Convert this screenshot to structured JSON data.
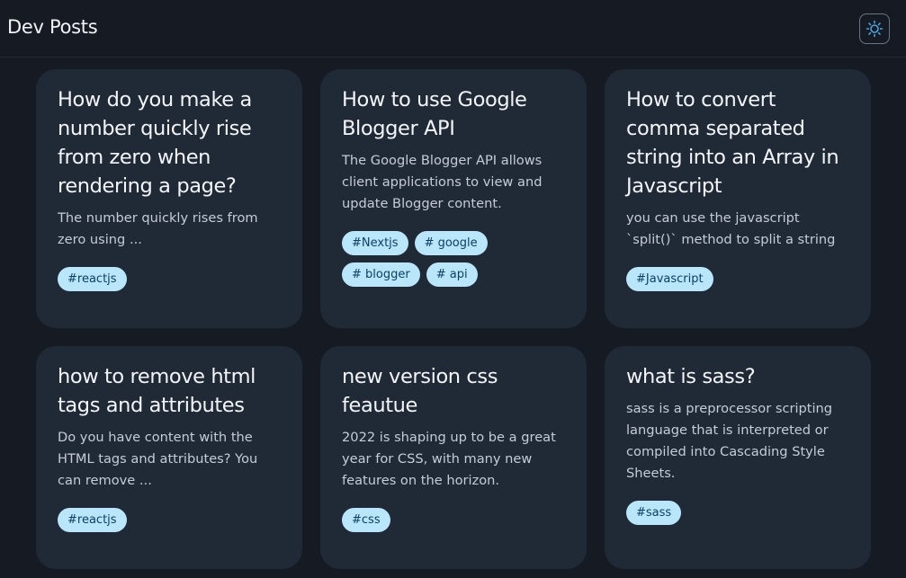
{
  "header": {
    "title": "Dev Posts",
    "theme_toggle_icon": "sun-icon",
    "accent_color": "#4aa3df"
  },
  "posts": [
    {
      "title": "How do you make a number quickly rise from zero when rendering a page?",
      "description": "The number quickly rises from zero using ...",
      "tags": [
        "#reactjs"
      ]
    },
    {
      "title": "How to use Google Blogger API",
      "description": "The Google Blogger API allows client applications to view and update Blogger content.",
      "tags": [
        "#Nextjs",
        "# google",
        "# blogger",
        "# api"
      ]
    },
    {
      "title": "How to convert comma separated string into an Array in Javascript",
      "description": "you can use the javascript `split()` method to split a string",
      "tags": [
        "#Javascript"
      ]
    },
    {
      "title": "how to remove html tags and attributes",
      "description": "Do you have content with the HTML tags and attributes? You can remove ...",
      "tags": [
        "#reactjs"
      ]
    },
    {
      "title": "new version css feautue",
      "description": "2022 is shaping up to be a great year for CSS, with many new features on the horizon.",
      "tags": [
        "#css"
      ]
    },
    {
      "title": "what is sass?",
      "description": "sass is a preprocessor scripting language that is interpreted or compiled into Cascading Style Sheets.",
      "tags": [
        "#sass"
      ]
    }
  ],
  "colors": {
    "background": "#151a23",
    "card": "#202a36",
    "tag_background": "#b9e6fb",
    "tag_text": "#0d3f66"
  }
}
